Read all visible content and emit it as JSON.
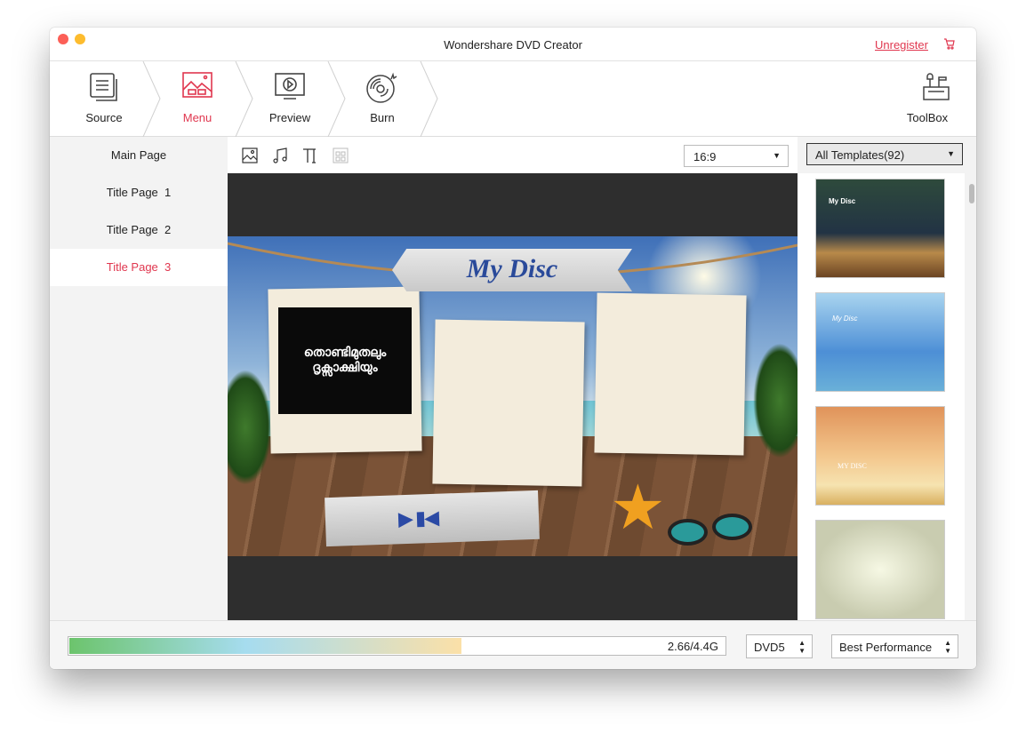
{
  "window": {
    "title": "Wondershare DVD Creator",
    "unregister": "Unregister",
    "cart_icon": "cart-icon",
    "accent": "#e0374f"
  },
  "steps": [
    {
      "label": "Source",
      "icon": "source-icon"
    },
    {
      "label": "Menu",
      "icon": "menu-icon",
      "active": true
    },
    {
      "label": "Preview",
      "icon": "preview-icon"
    },
    {
      "label": "Burn",
      "icon": "burn-icon"
    }
  ],
  "toolbox": {
    "label": "ToolBox",
    "icon": "toolbox-icon"
  },
  "pages": [
    {
      "label": "Main Page"
    },
    {
      "label": "Title Page  1"
    },
    {
      "label": "Title Page  2"
    },
    {
      "label": "Title Page  3",
      "selected": true
    }
  ],
  "editor": {
    "tools": [
      "background-image-icon",
      "music-icon",
      "text-icon",
      "grid-icon"
    ],
    "aspect_ratio": "16:9"
  },
  "menu_preview": {
    "title": "My Disc",
    "video_caption": "തൊണ്ടിമുതലും ദൃക്സാക്ഷിയും"
  },
  "templates": {
    "filter": "All Templates(92)",
    "items": [
      {
        "caption": "My Disc"
      },
      {
        "caption": "My Disc"
      },
      {
        "caption": "MY DISC"
      },
      {
        "caption": ""
      }
    ]
  },
  "footer": {
    "usage_text": "2.66/4.4G",
    "usage_percent": 60,
    "disc_type": "DVD5",
    "quality": "Best Performance"
  }
}
